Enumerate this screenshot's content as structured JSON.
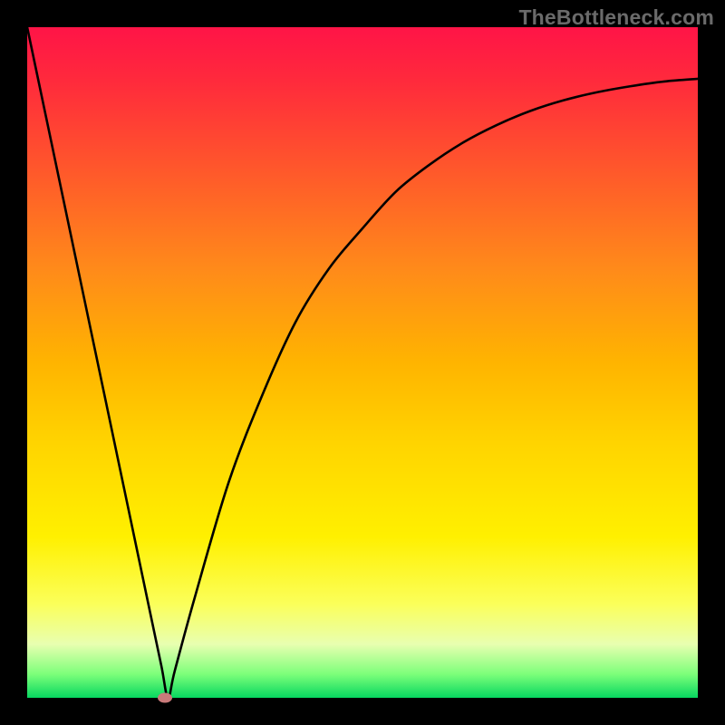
{
  "watermark": "TheBottleneck.com",
  "colors": {
    "frame": "#000000",
    "curve": "#000000",
    "marker": "#c97a7a",
    "gradient_top": "#ff1447",
    "gradient_bottom": "#07d760"
  },
  "chart_data": {
    "type": "line",
    "title": "",
    "xlabel": "",
    "ylabel": "",
    "xlim": [
      0,
      100
    ],
    "ylim": [
      0,
      100
    ],
    "grid": false,
    "legend": false,
    "series": [
      {
        "name": "bottleneck-curve",
        "x": [
          0,
          5,
          10,
          15,
          18,
          20,
          21,
          22,
          25,
          30,
          35,
          40,
          45,
          50,
          55,
          60,
          65,
          70,
          75,
          80,
          85,
          90,
          95,
          100
        ],
        "values": [
          100,
          76.2,
          52.4,
          28.6,
          14.3,
          4.8,
          0,
          4,
          15,
          32,
          45,
          56,
          64,
          70,
          75.5,
          79.5,
          82.8,
          85.4,
          87.5,
          89.1,
          90.3,
          91.2,
          91.9,
          92.3
        ]
      }
    ],
    "marker": {
      "x": 20.5,
      "y": 0
    },
    "annotations": []
  }
}
